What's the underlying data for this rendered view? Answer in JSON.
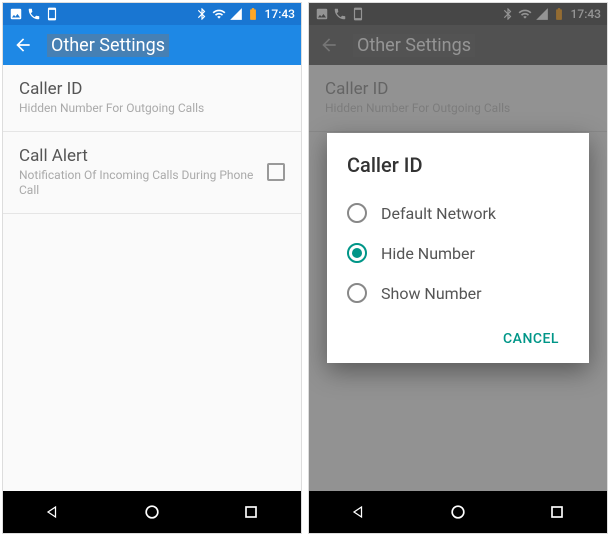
{
  "status": {
    "time": "17:43"
  },
  "header": {
    "title": "Other Settings"
  },
  "settings": {
    "callerId": {
      "title": "Caller ID",
      "subtitle": "Hidden Number For Outgoing Calls"
    },
    "callAlert": {
      "title": "Call Alert",
      "subtitle": "Notification Of Incoming Calls During Phone Call"
    }
  },
  "dialog": {
    "title": "Caller ID",
    "options": {
      "opt0": "Default Network",
      "opt1": "Hide Number",
      "opt2": "Show Number"
    },
    "cancel": "CANCEL"
  }
}
